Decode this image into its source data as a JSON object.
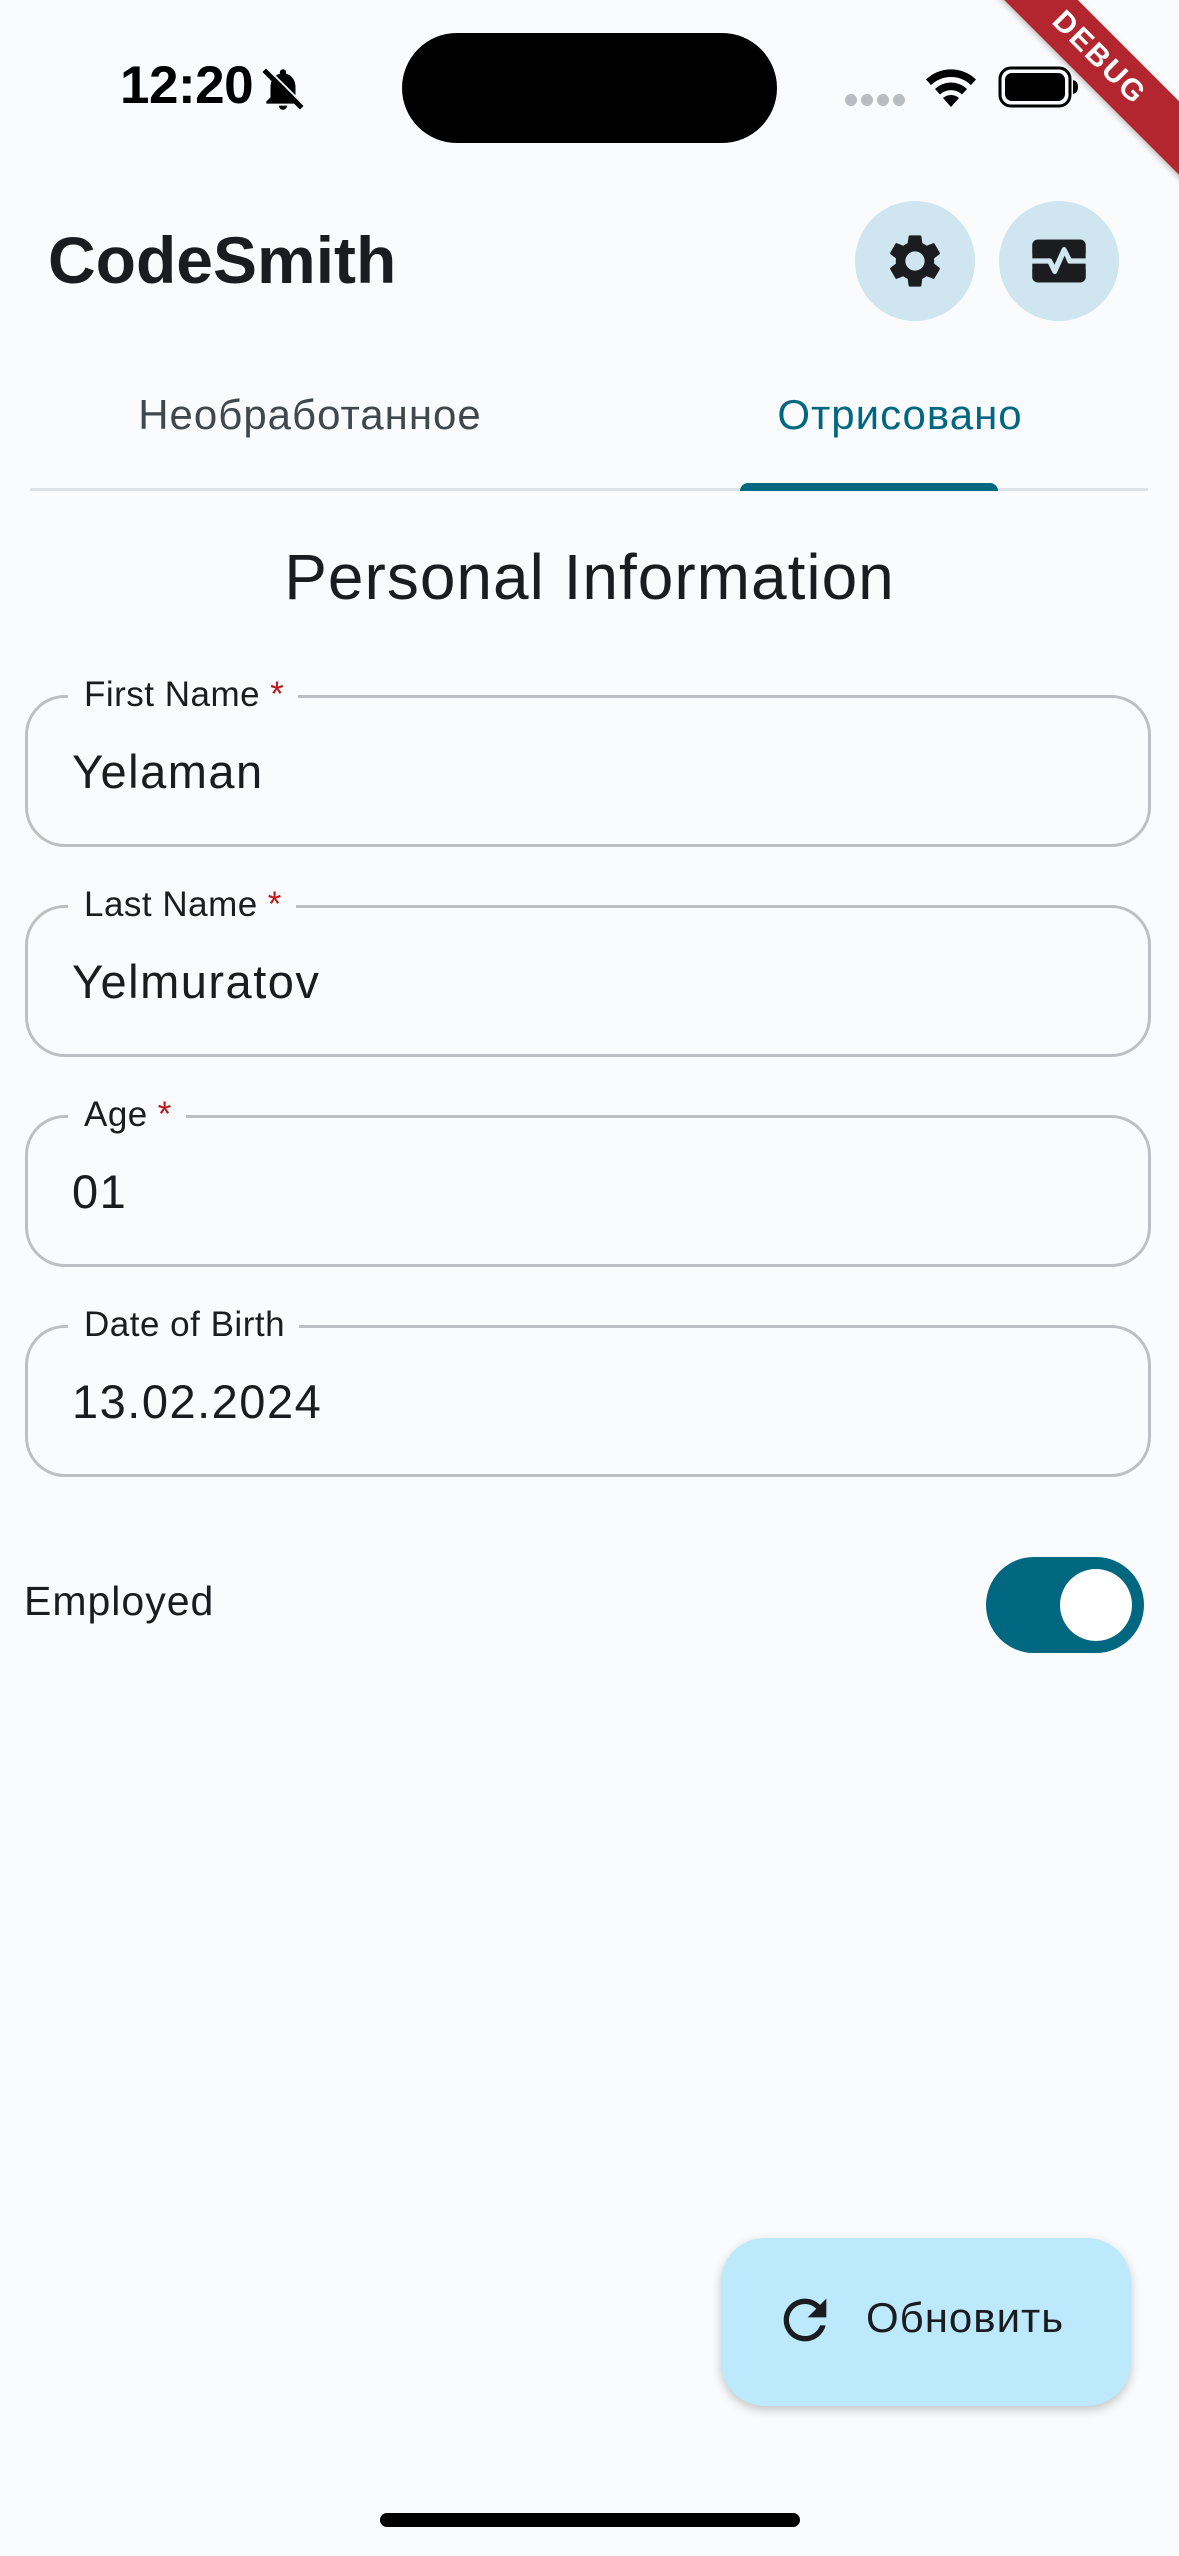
{
  "status_bar": {
    "time": "12:20"
  },
  "debug_banner": "DEBUG",
  "app_bar": {
    "title": "CodeSmith",
    "actions": [
      "gear-icon",
      "monitor-heart-icon"
    ]
  },
  "tabs": [
    {
      "label": "Необработанное",
      "selected": false
    },
    {
      "label": "Отрисовано",
      "selected": true
    }
  ],
  "form": {
    "title": "Personal Information",
    "fields": [
      {
        "label": "First Name",
        "required_mark": "*",
        "value": "Yelaman"
      },
      {
        "label": "Last Name",
        "required_mark": "*",
        "value": "Yelmuratov"
      },
      {
        "label": "Age",
        "required_mark": "*",
        "value": "01"
      },
      {
        "label": "Date of Birth",
        "value": "13.02.2024"
      }
    ],
    "employed": {
      "label": "Employed",
      "value": true
    }
  },
  "fab": {
    "label": "Обновить",
    "icon": "refresh-icon"
  },
  "colors": {
    "primary": "#006780",
    "icon_button_bg": "#cfe6f1",
    "fab_bg": "#bde9fc",
    "required": "#ba1a1a",
    "background": "#f9fbfd"
  }
}
